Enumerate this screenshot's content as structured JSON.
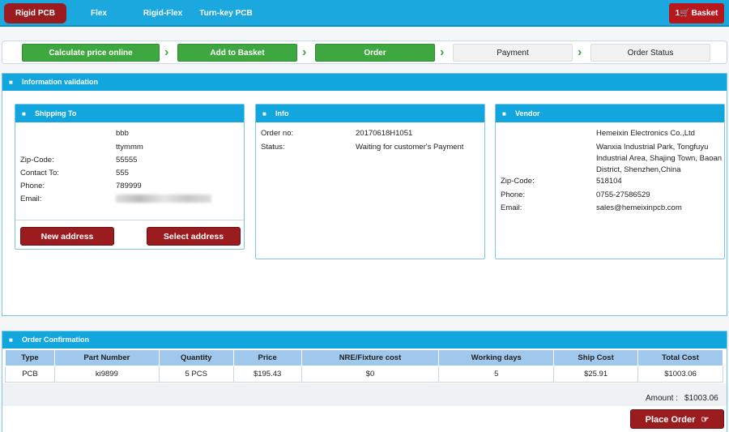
{
  "nav": {
    "items": [
      "Rigid PCB",
      "Flex",
      "Rigid-Flex",
      "Turn-key PCB"
    ],
    "active": 0,
    "basket_count": "1",
    "basket_label": "Basket"
  },
  "steps": [
    "Calculate price online",
    "Add to Basket",
    "Order",
    "Payment",
    "Order Status"
  ],
  "info_validation": {
    "title": "Information validation",
    "shipping": {
      "title": "Shipping To",
      "name": "bbb",
      "address": "ttymmm",
      "zip_label": "Zip-Code:",
      "zip": "55555",
      "contact_label": "Contact To:",
      "contact": "555",
      "phone_label": "Phone:",
      "phone": "789999",
      "email_label": "Email:",
      "new_address": "New address",
      "select_address": "Select address"
    },
    "info": {
      "title": "Info",
      "order_no_label": "Order no:",
      "order_no": "20170618H1051",
      "status_label": "Status:",
      "status": "Waiting for customer's Payment"
    },
    "vendor": {
      "title": "Vendor",
      "name": "Hemeixin Electronics Co.,Ltd",
      "address_l1": "Wanxia Industrial Park, Tongfuyu",
      "address_l2": "Industrial Area, Shajing Town, Baoan",
      "address_l3": "District, Shenzhen,China",
      "zip_label": "Zip-Code:",
      "zip": "518104",
      "phone_label": "Phone:",
      "phone": "0755-27586529",
      "email_label": "Email:",
      "email": "sales@hemeixinpcb.com"
    }
  },
  "order_confirmation": {
    "title": "Order Confirmation",
    "columns": [
      "Type",
      "Part Number",
      "Quantity",
      "Price",
      "NRE/Fixture cost",
      "Working days",
      "Ship Cost",
      "Total Cost"
    ],
    "rows": [
      [
        "PCB",
        "ki9899",
        "5 PCS",
        "$195.43",
        "$0",
        "5",
        "$25.91",
        "$1003.06"
      ]
    ],
    "amount_label": "Amount :",
    "amount": "$1003.06",
    "place_order": "Place Order"
  },
  "colors": {
    "primary_blue": "#12a6df",
    "accent_red": "#9b1c1f",
    "step_green": "#3fa73f"
  }
}
